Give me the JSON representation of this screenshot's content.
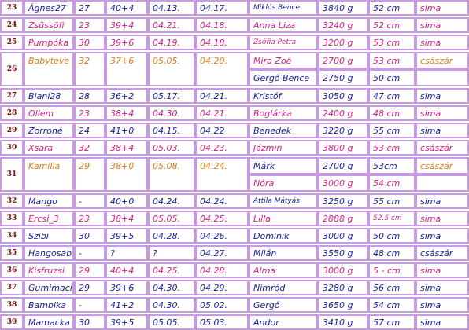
{
  "colors": {
    "blue": "#1a1a9a",
    "pink": "#d1207f",
    "orange": "#e07b19",
    "num": "#7a1010",
    "border": "#c69be0"
  },
  "rows": [
    {
      "num": "23",
      "nick": "Ágnes27",
      "age": "27",
      "week": "40+4",
      "due": "04.13.",
      "birth": "04.17.",
      "baby": "Miklós Bence",
      "weight": "3840 g",
      "length": "52 cm",
      "mode": "sima",
      "color": "blue",
      "baby_color": "blue",
      "mode_color": "pink"
    },
    {
      "num": "24",
      "nick": "Zsüssöfi",
      "age": "23",
      "week": "39+4",
      "due": "04.21.",
      "birth": "04.18.",
      "baby": "Anna Liza",
      "weight": "3240 g",
      "length": "52 cm",
      "mode": "sima",
      "color": "pink",
      "baby_color": "pink",
      "mode_color": "pink"
    },
    {
      "num": "25",
      "nick": "Pumpóka",
      "age": "30",
      "week": "39+6",
      "due": "04.19.",
      "birth": "04.18.",
      "baby": "Zsófia Petra",
      "weight": "3200 g",
      "length": "53 cm",
      "mode": "sima",
      "color": "pink",
      "baby_color": "pink",
      "mode_color": "pink"
    },
    {
      "num": "26",
      "nick": "Babyteve",
      "age": "32",
      "week": "37+6",
      "due": "05.05.",
      "birth": "04.20.",
      "baby": "Mira Zoé",
      "weight": "2700 g",
      "length": "53 cm",
      "mode": "császár",
      "color": "orange",
      "baby_color": "pink",
      "mode_color": "orange",
      "baby2": "Gergő Bence",
      "weight2": "2750 g",
      "length2": "50 cm",
      "baby2_color": "blue"
    },
    {
      "num": "27",
      "nick": "Blaní28",
      "age": "28",
      "week": "36+2",
      "due": "05.17.",
      "birth": "04.21.",
      "baby": "Kristóf",
      "weight": "3050 g",
      "length": "47 cm",
      "mode": "sima",
      "color": "blue",
      "baby_color": "blue",
      "mode_color": "blue"
    },
    {
      "num": "28",
      "nick": "Ollem",
      "age": "23",
      "week": "38+4",
      "due": "04.30.",
      "birth": "04.21.",
      "baby": "Boglárka",
      "weight": "2400 g",
      "length": "48 cm",
      "mode": "sima",
      "color": "pink",
      "baby_color": "pink",
      "mode_color": "pink"
    },
    {
      "num": "29",
      "nick": "Zorroné",
      "age": "24",
      "week": "41+0",
      "due": "04.15.",
      "birth": "04.22",
      "baby": "Benedek",
      "weight": "3220 g",
      "length": "55 cm",
      "mode": "sima",
      "color": "blue",
      "baby_color": "blue",
      "mode_color": "blue"
    },
    {
      "num": "30",
      "nick": "Xsara",
      "age": "32",
      "week": "38+4",
      "due": "05.03.",
      "birth": "04.23.",
      "baby": "Jázmin",
      "weight": "3800 g",
      "length": "53 cm",
      "mode": "császár",
      "color": "pink",
      "baby_color": "pink",
      "mode_color": "pink"
    },
    {
      "num": "31",
      "nick": "Kamilla",
      "age": "29",
      "week": "38+0",
      "due": "05.08.",
      "birth": "04.24.",
      "baby": "Márk",
      "weight": "2700 g",
      "length": "53cm",
      "mode": "császár",
      "color": "orange",
      "baby_color": "blue",
      "mode_color": "orange",
      "baby2": "Nóra",
      "weight2": "3000 g",
      "length2": "54 cm",
      "baby2_color": "pink"
    },
    {
      "num": "32",
      "nick": "Mango",
      "age": "-",
      "week": "40+0",
      "due": "04.24.",
      "birth": "04.24.",
      "baby": "Attila Mátyás",
      "weight": "3250 g",
      "length": "55 cm",
      "mode": "sima",
      "color": "blue",
      "baby_color": "blue",
      "mode_color": "blue"
    },
    {
      "num": "33",
      "nick": "Ercsi_3",
      "age": "23",
      "week": "38+4",
      "due": "05.05.",
      "birth": "04.25.",
      "baby": "Lilla",
      "weight": "2888 g",
      "length": "52.5 cm",
      "mode": "sima",
      "color": "pink",
      "baby_color": "pink",
      "mode_color": "pink"
    },
    {
      "num": "34",
      "nick": "Szibi",
      "age": "30",
      "week": "39+5",
      "due": "04.28.",
      "birth": "04.26.",
      "baby": "Dominik",
      "weight": "3000 g",
      "length": "50 cm",
      "mode": "sima",
      "color": "blue",
      "baby_color": "blue",
      "mode_color": "blue"
    },
    {
      "num": "35",
      "nick": "Hangosab",
      "age": "-",
      "week": "?",
      "due": "?",
      "birth": "04.27.",
      "baby": "Milán",
      "weight": "3550 g",
      "length": "48 cm",
      "mode": "császár",
      "color": "blue",
      "baby_color": "blue",
      "mode_color": "blue"
    },
    {
      "num": "36",
      "nick": "Kisfruzsi",
      "age": "29",
      "week": "40+4",
      "due": "04.25.",
      "birth": "04.28.",
      "baby": "Alma",
      "weight": "3000 g",
      "length": "5 - cm",
      "mode": "sima",
      "color": "pink",
      "baby_color": "pink",
      "mode_color": "pink"
    },
    {
      "num": "37",
      "nick": "Gumimaci",
      "age": "29",
      "week": "39+6",
      "due": "04.30.",
      "birth": "04.29.",
      "baby": "Nimród",
      "weight": "3280 g",
      "length": "56 cm",
      "mode": "sima",
      "color": "blue",
      "baby_color": "blue",
      "mode_color": "blue"
    },
    {
      "num": "38",
      "nick": "Bambika",
      "age": "-",
      "week": "41+2",
      "due": "04.30.",
      "birth": "05.02.",
      "baby": "Gergő",
      "weight": "3650 g",
      "length": "54 cm",
      "mode": "sima",
      "color": "blue",
      "baby_color": "blue",
      "mode_color": "blue"
    },
    {
      "num": "39",
      "nick": "Mamacka",
      "age": "30",
      "week": "39+5",
      "due": "05.05.",
      "birth": "05.03.",
      "baby": "Andor",
      "weight": "3410 g",
      "length": "57 cm",
      "mode": "sima",
      "color": "blue",
      "baby_color": "blue",
      "mode_color": "blue"
    }
  ]
}
